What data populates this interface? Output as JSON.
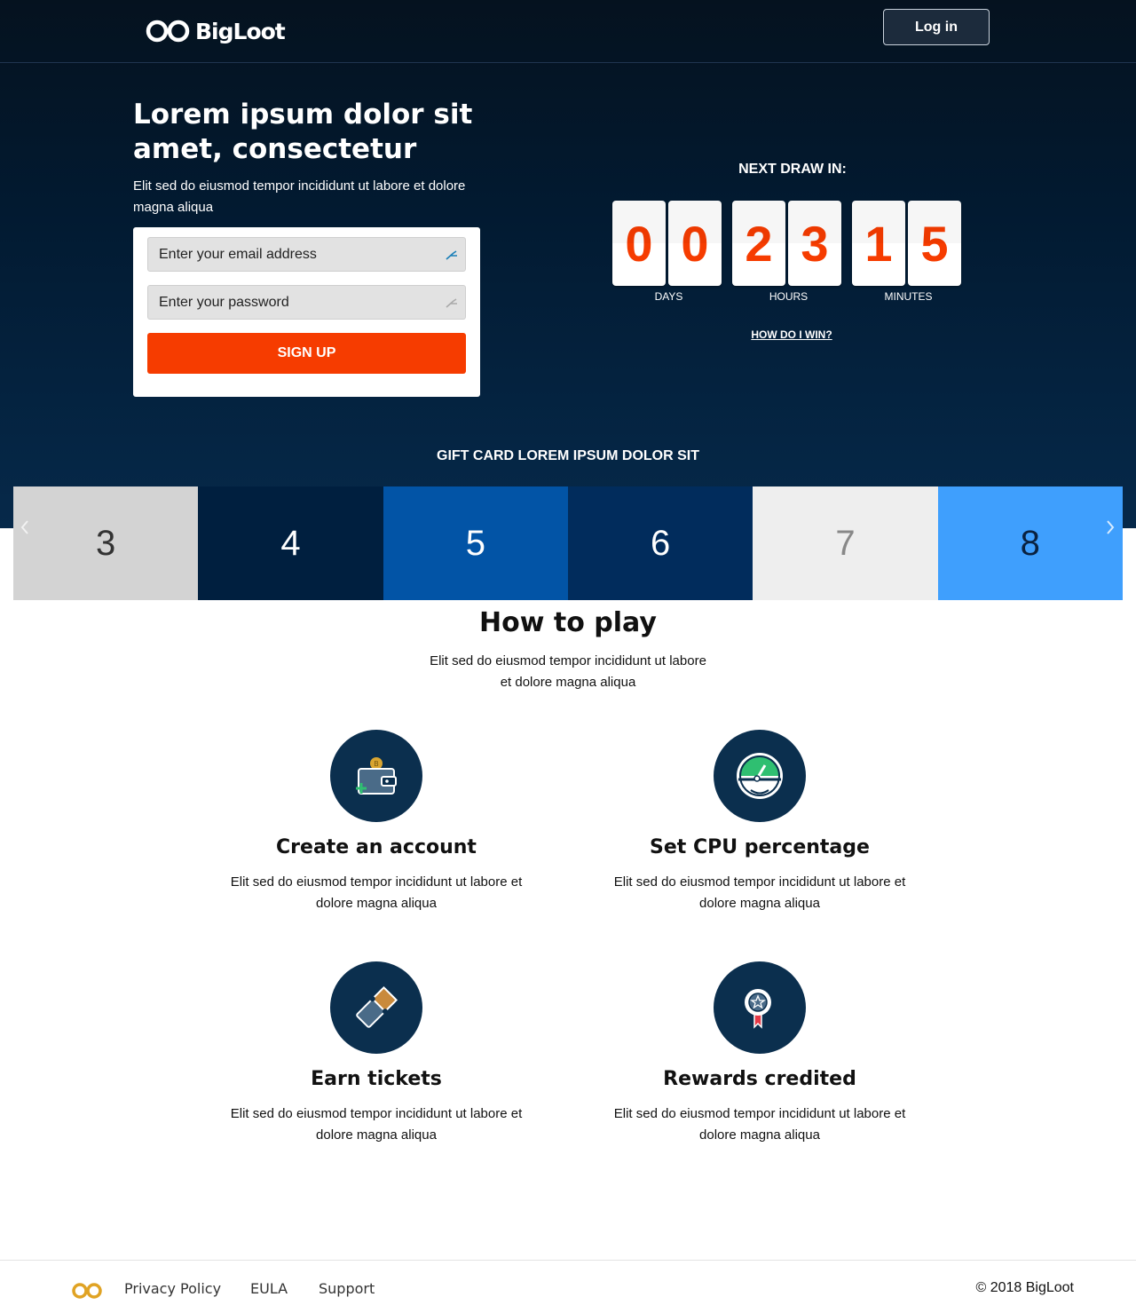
{
  "header": {
    "logo_text": "BigLoot",
    "login_label": "Log in"
  },
  "hero": {
    "title": "Lorem ipsum dolor sit amet, consectetur",
    "subtitle": "Elit sed do eiusmod tempor incididunt ut labore et dolore magna aliqua",
    "email_placeholder": "Enter your email address",
    "password_placeholder": "Enter your password",
    "signup_label": "SIGN UP"
  },
  "countdown": {
    "label": "NEXT DRAW IN:",
    "days_digits": [
      "0",
      "0"
    ],
    "hours_digits": [
      "2",
      "3"
    ],
    "minutes_digits": [
      "1",
      "5"
    ],
    "days_label": "DAYS",
    "hours_label": "HOURS",
    "minutes_label": "MINUTES",
    "how_win_label": "HOW DO I WIN?",
    "digit_color": "#f63c00"
  },
  "gift": {
    "title": "GIFT CARD LOREM IPSUM DOLOR SIT",
    "slides": [
      {
        "label": "3",
        "bg": "#d3d3d3",
        "fg": "#333333"
      },
      {
        "label": "4",
        "bg": "#001f3f",
        "fg": "#ffffff"
      },
      {
        "label": "5",
        "bg": "#0254a6",
        "fg": "#ffffff"
      },
      {
        "label": "6",
        "bg": "#012c5c",
        "fg": "#ffffff"
      },
      {
        "label": "7",
        "bg": "#eeeeee",
        "fg": "#888888"
      },
      {
        "label": "8",
        "bg": "#3f9ffd",
        "fg": "#0a2240"
      }
    ]
  },
  "how_to_play": {
    "title": "How to play",
    "subtitle": "Elit sed do eiusmod tempor incididunt ut labore et dolore magna aliqua",
    "steps": [
      {
        "title": "Create an account",
        "desc": "Elit sed do eiusmod tempor incididunt ut labore et dolore magna aliqua",
        "icon": "wallet-icon"
      },
      {
        "title": "Set CPU percentage",
        "desc": "Elit sed do eiusmod tempor incididunt ut labore et dolore magna aliqua",
        "icon": "gauge-icon"
      },
      {
        "title": "Earn tickets",
        "desc": "Elit sed do eiusmod tempor incididunt ut labore et dolore magna aliqua",
        "icon": "ticket-icon"
      },
      {
        "title": "Rewards credited",
        "desc": "Elit sed do eiusmod tempor incididunt ut labore et dolore magna aliqua",
        "icon": "award-icon"
      }
    ]
  },
  "footer": {
    "links": [
      "Privacy Policy",
      "EULA",
      "Support"
    ],
    "copyright": "© 2018 BigLoot"
  },
  "colors": {
    "accent": "#f63c00",
    "hero_dark": "#021a31",
    "badge": "#0b2f4e"
  }
}
